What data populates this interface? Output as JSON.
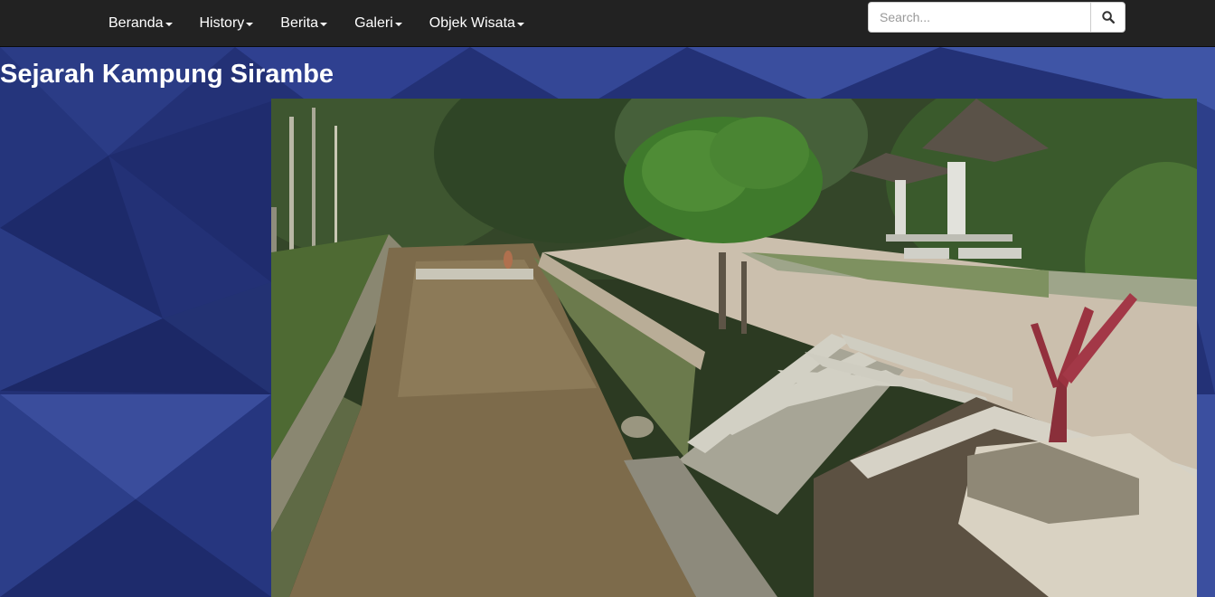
{
  "nav": {
    "items": [
      {
        "label": "Beranda"
      },
      {
        "label": "History"
      },
      {
        "label": "Berita"
      },
      {
        "label": "Galeri"
      },
      {
        "label": "Objek Wisata"
      }
    ]
  },
  "search": {
    "placeholder": "Search...",
    "button_icon": "search-icon"
  },
  "page": {
    "title": "Sejarah Kampung Sirambe"
  },
  "colors": {
    "navbar": "#222222",
    "background": "#243378",
    "text": "#ffffff"
  }
}
